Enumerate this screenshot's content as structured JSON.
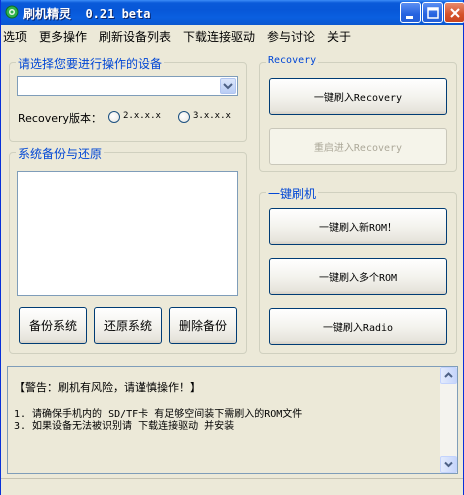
{
  "window": {
    "title": "刷机精灵  0.21 beta"
  },
  "menu": [
    "选项",
    "更多操作",
    "刷新设备列表",
    "下载连接驱动",
    "参与讨论",
    "关于"
  ],
  "device_group": {
    "title": "请选择您要进行操作的设备",
    "selected_device": "",
    "recovery_label_cn": "Recovery版本：",
    "radio_options": [
      "2.x.x.x",
      "3.x.x.x"
    ]
  },
  "backup_group": {
    "title": "系统备份与还原",
    "buttons": [
      "备份系统",
      "还原系统",
      "删除备份"
    ]
  },
  "recovery_group": {
    "title": "Recovery",
    "buttons": [
      "一键刷入Recovery",
      "重启进入Recovery"
    ]
  },
  "flash_group": {
    "title": "一键刷机",
    "buttons": [
      "一键刷入新ROM！",
      "一键刷入多个ROM",
      "一键刷入Radio"
    ]
  },
  "log": {
    "warning": "【警告：刷机有风险，请谨慎操作！】",
    "lines": [
      "1. 请确保手机内的 SD/TF卡 有足够空间装下需刷入的ROM文件",
      "3. 如果设备无法被识别请 下载连接驱动 并安装"
    ]
  },
  "colors": {
    "titlebar": "#0a5ad9",
    "group_title": "#0046d5",
    "disabled_text": "#aca899"
  }
}
